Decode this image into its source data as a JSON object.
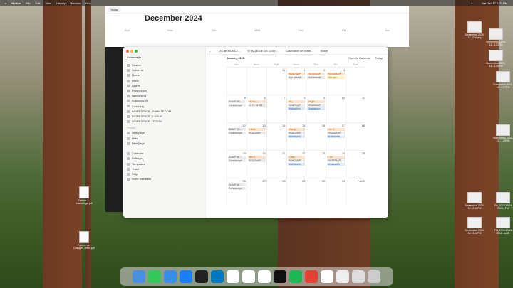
{
  "menubar": {
    "app": "Notion",
    "items": [
      "File",
      "Edit",
      "View",
      "History",
      "Window",
      "Help"
    ],
    "clock": "Sat Dec 17 1:07 PM"
  },
  "calendar_app": {
    "title": "December 2024",
    "today_btn": "Today",
    "days": [
      "Sun",
      "Mon",
      "Tue",
      "Wed",
      "Thu",
      "Fri",
      "Sat"
    ]
  },
  "notion": {
    "workspace": "Autoconfy",
    "nav": [
      "Search",
      "Notion AI",
      "Home",
      "Inbox"
    ],
    "sections": [
      "Sweet",
      "Prospection",
      "Networking",
      "Autoconfy IO",
      "Coaching",
      "WORKSPACE - FAMILLEDOM",
      "WORKSPACE - LUDUF",
      "WORKSPACE - TODAY"
    ],
    "private_label": "Private",
    "private_items": [
      "New page",
      "Lists",
      "New page"
    ],
    "bottom_items": [
      "Calendar",
      "Settings",
      "Templates",
      "Trash",
      "Help"
    ],
    "invite": "Invite members",
    "tabs": [
      "OS de MONCT...",
      "STRATÉGIE DE CONT...",
      "Calendrier de conte..."
    ],
    "share": "Share",
    "open_label": "Open in Calendar",
    "today": "Today",
    "month": "January 2025",
    "weekdays": [
      "Sun",
      "Mon",
      "Tue",
      "Wed",
      "Thu",
      "Fri",
      "Sat"
    ],
    "weeks": [
      [
        {
          "n": ""
        },
        {
          "n": ""
        },
        {
          "n": "31"
        },
        {
          "n": "1",
          "c": [
            [
              "orange",
              "ROADMAP"
            ],
            [
              "gray",
              "Non faisant"
            ]
          ]
        },
        {
          "n": "2",
          "c": [
            [
              "orange",
              "ROADMAP"
            ],
            [
              "gray",
              "Non faisant"
            ]
          ]
        },
        {
          "n": "3",
          "c": [
            [
              "orange",
              "ROADMAP"
            ],
            [
              "yellow",
              "Nav qu..."
            ]
          ]
        },
        {
          "n": ""
        }
      ],
      [
        {
          "n": "5",
          "c": [
            [
              "gray",
              "DUMP SE..."
            ],
            [
              "gray",
              "Connaculpe"
            ]
          ]
        },
        {
          "n": "6",
          "c": [
            [
              "orange",
              "Le foa..."
            ],
            [
              "gray",
              "CHECKLIST"
            ]
          ]
        },
        {
          "n": "7"
        },
        {
          "n": "8",
          "c": [
            [
              "orange",
              "Mo..."
            ],
            [
              "gray",
              "ROADMAP"
            ],
            [
              "blue",
              "Brainstorm"
            ]
          ]
        },
        {
          "n": "9",
          "c": [
            [
              "orange",
              "La gui..."
            ],
            [
              "gray",
              "ROADMAP"
            ],
            [
              "blue",
              "Brainstorm"
            ]
          ]
        },
        {
          "n": "10"
        },
        {
          "n": "11"
        }
      ],
      [
        {
          "n": "12",
          "c": [
            [
              "gray",
              "DUMP SE..."
            ],
            [
              "gray",
              "Connaculpe"
            ]
          ]
        },
        {
          "n": "13",
          "c": [
            [
              "orange",
              "5 tech..."
            ],
            [
              "gray",
              "ROADMAP"
            ]
          ]
        },
        {
          "n": "14"
        },
        {
          "n": "15",
          "c": [
            [
              "orange",
              "Unpop..."
            ],
            [
              "gray",
              "ROADMAP"
            ],
            [
              "blue",
              "Brainstorm"
            ]
          ]
        },
        {
          "n": "16"
        },
        {
          "n": "17",
          "c": [
            [
              "orange",
              "Les 3..."
            ],
            [
              "gray",
              "ROADMAP"
            ],
            [
              "blue",
              "Brainstorm"
            ]
          ]
        },
        {
          "n": "18"
        }
      ],
      [
        {
          "n": "19",
          "c": [
            [
              "gray",
              "DUMP se..."
            ],
            [
              "gray",
              "Connaculpe"
            ]
          ]
        },
        {
          "n": "20",
          "c": [
            [
              "orange",
              "Une li..."
            ],
            [
              "gray",
              "ROADMAP"
            ]
          ]
        },
        {
          "n": "21"
        },
        {
          "n": "22",
          "c": [
            [
              "orange",
              "L'inter..."
            ],
            [
              "gray",
              "ROADMAP"
            ],
            [
              "blue",
              "Brainstorm"
            ]
          ]
        },
        {
          "n": "23"
        },
        {
          "n": "24",
          "c": [
            [
              "orange",
              "L'ut..."
            ],
            [
              "gray",
              "ROADMAP"
            ],
            [
              "blue",
              "Brainstorm"
            ]
          ]
        },
        {
          "n": "25"
        }
      ],
      [
        {
          "n": "26",
          "c": [
            [
              "gray",
              "DUMP se..."
            ],
            [
              "gray",
              "Connaculpe"
            ]
          ]
        },
        {
          "n": "27"
        },
        {
          "n": "28"
        },
        {
          "n": "29"
        },
        {
          "n": "30"
        },
        {
          "n": "31"
        },
        {
          "n": "Feb 1"
        }
      ]
    ]
  },
  "desktop_files": [
    {
      "label": "Screenshot 2024-12...PM.png"
    },
    {
      "label": "Screenshot 2024-12...1.52PM"
    },
    {
      "label": "Screenshot 2024-12...1.00PM"
    },
    {
      "label": "Screenshot 2024-12...7.07PM"
    },
    {
      "label": "Screenshot 2024-12...7.20PM"
    },
    {
      "label": "Screenshot 2024-12...2.05PM"
    },
    {
      "label": "Fin_2024/12/14 2024...PM"
    },
    {
      "label": "Screenshot 2024-12...3.00PM"
    },
    {
      "label": "Fin_2024/12/14 2024...dd4R"
    }
  ],
  "left_files": [
    {
      "label": "Facture-...-marketinge.pdf"
    },
    {
      "label": "Facture-de-Dranger...client.pdf"
    }
  ]
}
